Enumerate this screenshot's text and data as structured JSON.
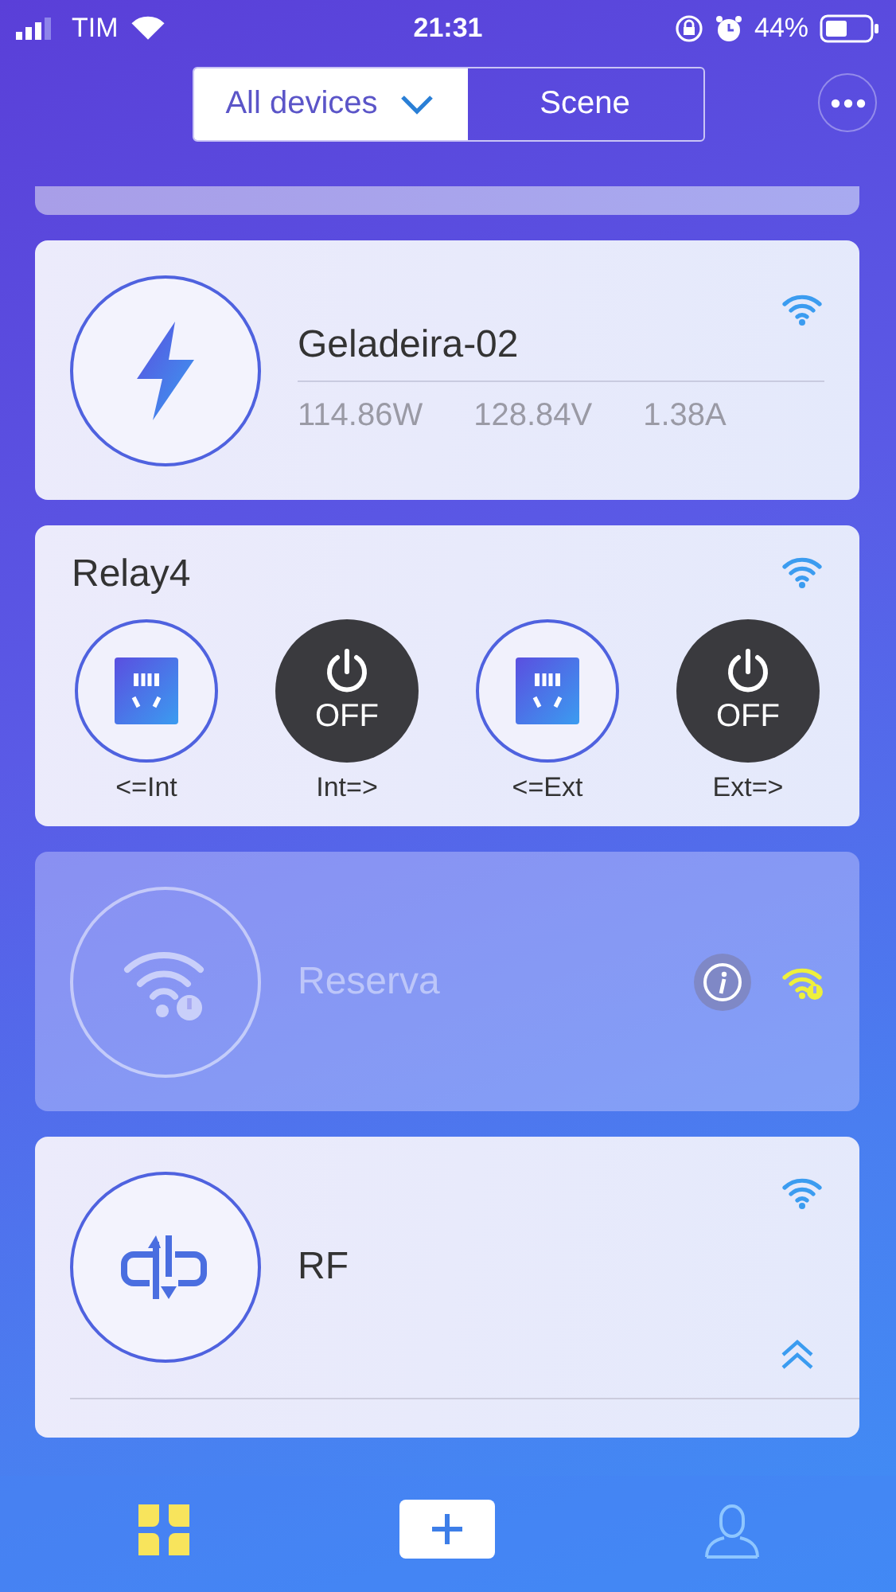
{
  "status_bar": {
    "carrier": "TIM",
    "time": "21:31",
    "battery": "44%"
  },
  "header": {
    "segments": [
      {
        "label": "All devices",
        "selected": true,
        "kind": "dropdown"
      },
      {
        "label": "Scene",
        "selected": false,
        "kind": "plain"
      }
    ]
  },
  "devices": [
    {
      "kind": "meter",
      "name": "Geladeira-02",
      "online": true,
      "readings": [
        "114.86W",
        "128.84V",
        "1.38A"
      ]
    },
    {
      "kind": "relay",
      "name": "Relay4",
      "online": true,
      "channels": [
        {
          "label": "<=Int",
          "on": true
        },
        {
          "label": "Int=>",
          "on": false,
          "badge": "OFF"
        },
        {
          "label": "<=Ext",
          "on": true
        },
        {
          "label": "Ext=>",
          "on": false,
          "badge": "OFF"
        }
      ]
    },
    {
      "kind": "plain",
      "name": "Reserva",
      "online": false
    },
    {
      "kind": "rf",
      "name": "RF",
      "online": true
    }
  ],
  "nav": [
    {
      "kind": "devices",
      "selected": true
    },
    {
      "kind": "add",
      "selected": false
    },
    {
      "kind": "profile",
      "selected": false
    }
  ]
}
